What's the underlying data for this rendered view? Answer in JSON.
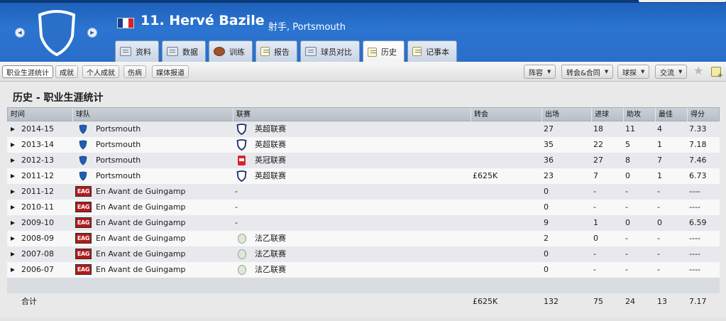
{
  "header": {
    "player_number_name": "11. Hervé Bazile",
    "position_club": "射手, Portsmouth",
    "flag_colors": [
      "#1a3d94",
      "#ffffff",
      "#d6222b"
    ]
  },
  "tabs": [
    {
      "label": "资料",
      "icon": "profile-icon"
    },
    {
      "label": "数据",
      "icon": "stats-icon"
    },
    {
      "label": "训练",
      "icon": "training-ball-icon"
    },
    {
      "label": "报告",
      "icon": "report-icon"
    },
    {
      "label": "球员对比",
      "icon": "compare-icon"
    },
    {
      "label": "历史",
      "icon": "history-icon",
      "active": true
    },
    {
      "label": "记事本",
      "icon": "notebook-icon"
    }
  ],
  "subtabs": [
    "职业生涯统计",
    "成就",
    "个人成就",
    "伤病",
    "媒体报道"
  ],
  "toolbar": {
    "squad": "阵容",
    "transfer": "转会&合同",
    "scouting": "球探",
    "interact": "交流"
  },
  "content": {
    "title": "历史 - 职业生涯统计"
  },
  "table": {
    "columns": [
      "时间",
      "球队",
      "联赛",
      "转会",
      "出场",
      "进球",
      "助攻",
      "最佳",
      "得分"
    ],
    "rows": [
      {
        "season": "2014-15",
        "team": "Portsmouth",
        "league": "英超联赛",
        "fee": "",
        "apps": "27",
        "goals": "18",
        "assists": "11",
        "pom": "4",
        "rating": "7.33",
        "league_logo": "premier-league-shield"
      },
      {
        "season": "2013-14",
        "team": "Portsmouth",
        "league": "英超联赛",
        "fee": "",
        "apps": "35",
        "goals": "22",
        "assists": "5",
        "pom": "1",
        "rating": "7.18",
        "league_logo": "premier-league-shield"
      },
      {
        "season": "2012-13",
        "team": "Portsmouth",
        "league": "英冠联赛",
        "fee": "",
        "apps": "36",
        "goals": "27",
        "assists": "8",
        "pom": "7",
        "rating": "7.46",
        "league_logo": "championship-red"
      },
      {
        "season": "2011-12",
        "team": "Portsmouth",
        "league": "英超联赛",
        "fee": "£625K",
        "apps": "23",
        "goals": "7",
        "assists": "0",
        "pom": "1",
        "rating": "6.73",
        "league_logo": "premier-league-shield"
      },
      {
        "season": "2011-12",
        "team": "En Avant de Guingamp",
        "league": "-",
        "fee": "",
        "apps": "0",
        "goals": "-",
        "assists": "-",
        "pom": "-",
        "rating": "----",
        "league_logo": ""
      },
      {
        "season": "2010-11",
        "team": "En Avant de Guingamp",
        "league": "-",
        "fee": "",
        "apps": "0",
        "goals": "-",
        "assists": "-",
        "pom": "-",
        "rating": "----",
        "league_logo": ""
      },
      {
        "season": "2009-10",
        "team": "En Avant de Guingamp",
        "league": "-",
        "fee": "",
        "apps": "9",
        "goals": "1",
        "assists": "0",
        "pom": "0",
        "rating": "6.59",
        "league_logo": ""
      },
      {
        "season": "2008-09",
        "team": "En Avant de Guingamp",
        "league": "法乙联赛",
        "fee": "",
        "apps": "2",
        "goals": "0",
        "assists": "-",
        "pom": "-",
        "rating": "----",
        "league_logo": "ligue2-ball"
      },
      {
        "season": "2007-08",
        "team": "En Avant de Guingamp",
        "league": "法乙联赛",
        "fee": "",
        "apps": "0",
        "goals": "-",
        "assists": "-",
        "pom": "-",
        "rating": "----",
        "league_logo": "ligue2-ball"
      },
      {
        "season": "2006-07",
        "team": "En Avant de Guingamp",
        "league": "法乙联赛",
        "fee": "",
        "apps": "0",
        "goals": "-",
        "assists": "-",
        "pom": "-",
        "rating": "----",
        "league_logo": "ligue2-ball"
      }
    ],
    "guingamp_badge_text": "EAG",
    "total": {
      "label": "合计",
      "fee": "£625K",
      "apps": "132",
      "goals": "75",
      "assists": "24",
      "pom": "13",
      "rating": "7.17"
    }
  }
}
